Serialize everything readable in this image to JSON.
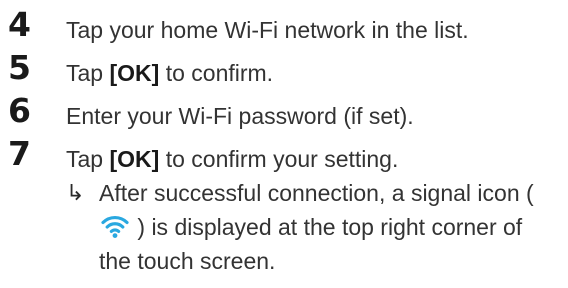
{
  "steps": [
    {
      "number": "4",
      "text": "Tap your home Wi-Fi network in the list."
    },
    {
      "number": "5",
      "prefix": "Tap ",
      "button": "[OK]",
      "suffix": " to confirm."
    },
    {
      "number": "6",
      "text": "Enter your Wi-Fi password (if set)."
    },
    {
      "number": "7",
      "prefix": "Tap ",
      "button": "[OK]",
      "suffix": " to confirm your setting."
    }
  ],
  "result": {
    "arrow": "↳",
    "before_icon": "After successful connection, a signal icon ( ",
    "after_icon": " ) is displayed at the top right corner of the touch screen.",
    "icon": "wifi-icon",
    "icon_color": "#2aa8e0"
  }
}
